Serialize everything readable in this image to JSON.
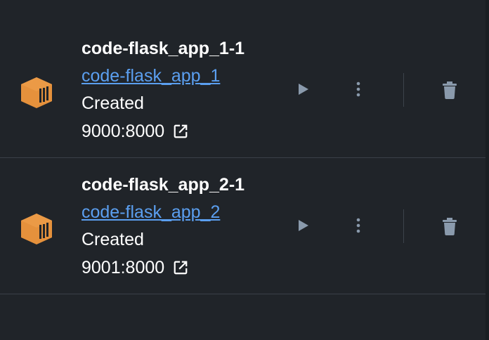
{
  "containers": [
    {
      "name": "code-flask_app_1-1",
      "image": "code-flask_app_1",
      "status": "Created",
      "ports": "9000:8000"
    },
    {
      "name": "code-flask_app_2-1",
      "image": "code-flask_app_2",
      "status": "Created",
      "ports": "9001:8000"
    }
  ],
  "colors": {
    "background": "#202429",
    "container_icon": "#e5913c",
    "link": "#5b9ff0",
    "action_icon": "#8a9aac",
    "divider": "#3c434b"
  },
  "icons": {
    "container": "container-icon",
    "external_link": "external-link-icon",
    "start": "play-icon",
    "more": "kebab-menu-icon",
    "delete": "trash-icon"
  }
}
